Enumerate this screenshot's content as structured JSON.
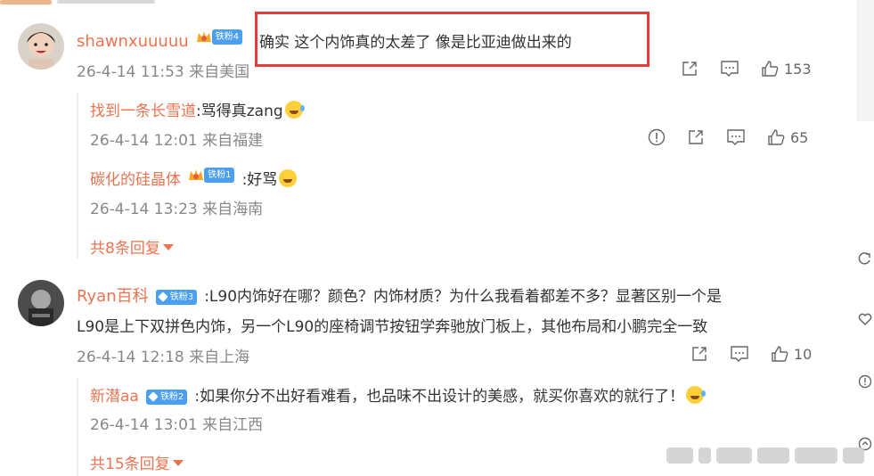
{
  "comments": [
    {
      "user": "shawnxuuuuu",
      "badge": "铁粉4",
      "text": "确实 这个内饰真的太差了 像是比亚迪做出来的",
      "time": "26-4-14 11:53",
      "location": "来自美国",
      "likes": "153",
      "replies": [
        {
          "user": "找到一条长雪道",
          "text": ":骂得真zang",
          "time": "26-4-14 12:01",
          "location": "来自福建",
          "likes": "65"
        },
        {
          "user": "碳化的硅晶体",
          "badge": "铁粉1",
          "text": ":好骂",
          "time": "26-4-14 13:23",
          "location": "来自海南"
        }
      ],
      "more_replies": "共8条回复"
    },
    {
      "user": "Ryan百科",
      "badge": "铁粉3",
      "text_line1": ":L90内饰好在哪？颜色？内饰材质？为什么我看着都差不多？显著区别一个是",
      "text_line2": "L90是上下双拼色内饰，另一个L90的座椅调节按钮学奔驰放门板上，其他布局和小鹏完全一致",
      "time": "26-4-14 12:18",
      "location": "来自上海",
      "likes": "10",
      "replies": [
        {
          "user": "新潜aa",
          "badge": "铁粉2",
          "text": ":如果你分不出好看难看，也品味不出设计的美感，就买你喜欢的就行了！",
          "time": "26-4-14 13:01",
          "location": "来自江西"
        }
      ],
      "more_replies": "共15条回复"
    }
  ],
  "colors": {
    "name": "#eb7350",
    "badge": "#4a9ff0",
    "highlight": "#e23b3b",
    "meta": "#888888"
  },
  "icons": [
    "share-icon",
    "comment-icon",
    "like-icon",
    "report-icon",
    "refresh-icon",
    "heart-icon",
    "info-icon"
  ]
}
